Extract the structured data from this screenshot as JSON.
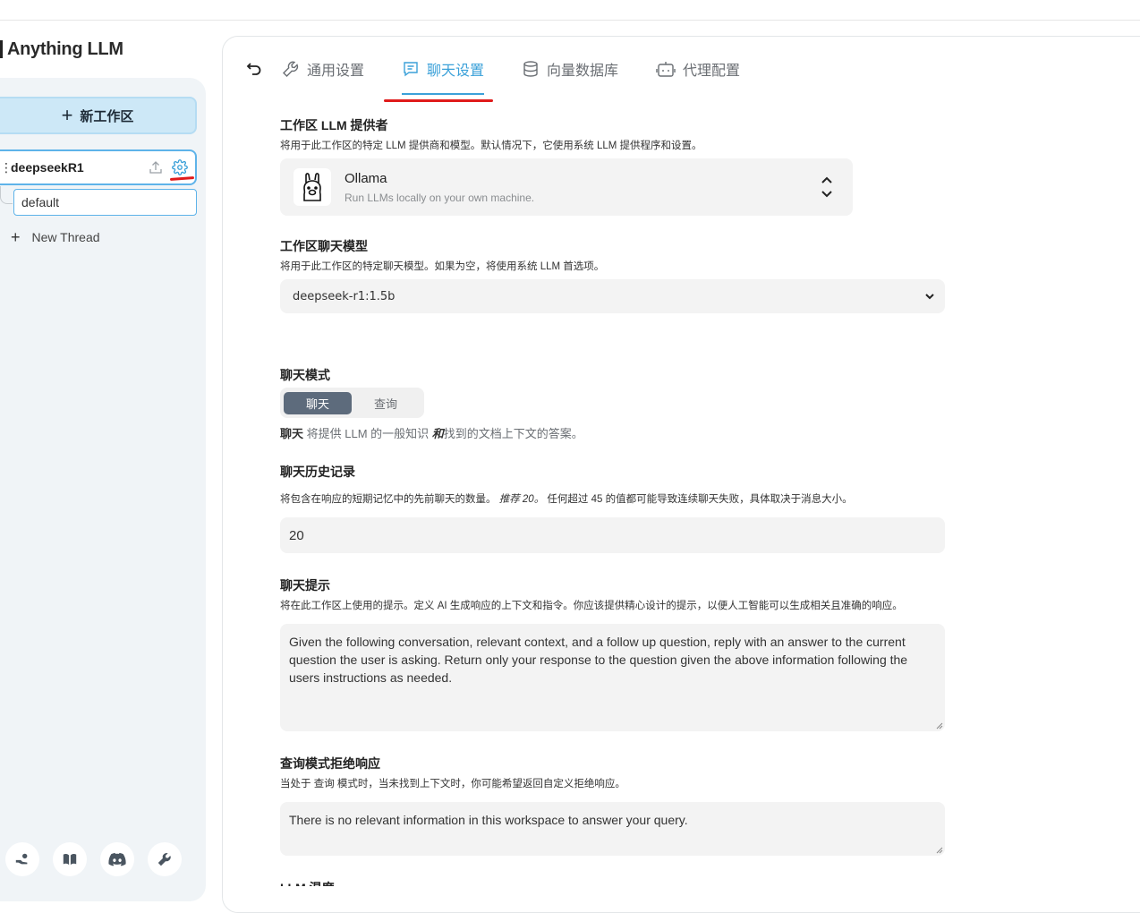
{
  "app": {
    "title": "Anything LLM"
  },
  "sidebar": {
    "new_workspace_label": "新工作区",
    "workspace": {
      "name": "deepseekR1"
    },
    "thread_default": "default",
    "new_thread_label": "New Thread",
    "footer_icons": [
      "community-hub-icon",
      "docs-book-icon",
      "discord-icon",
      "wrench-settings-icon"
    ]
  },
  "tabs": [
    {
      "label": "通用设置",
      "icon": "wrench-icon"
    },
    {
      "label": "聊天设置",
      "icon": "chat-icon",
      "active": true
    },
    {
      "label": "向量数据库",
      "icon": "database-icon"
    },
    {
      "label": "代理配置",
      "icon": "robot-icon"
    }
  ],
  "settings": {
    "provider": {
      "title": "工作区 LLM 提供者",
      "desc": "将用于此工作区的特定 LLM 提供商和模型。默认情况下，它使用系统 LLM 提供程序和设置。",
      "name": "Ollama",
      "subtitle": "Run LLMs locally on your own machine."
    },
    "model": {
      "title": "工作区聊天模型",
      "desc": "将用于此工作区的特定聊天模型。如果为空，将使用系统 LLM 首选项。",
      "value": "deepseek-r1:1.5b"
    },
    "mode": {
      "title": "聊天模式",
      "options": [
        "聊天",
        "查询"
      ],
      "selected": "聊天",
      "desc_lead": "聊天",
      "desc_mid": " 将提供 LLM 的一般知识 ",
      "desc_and": "和",
      "desc_tail": "找到的文档上下文的答案。"
    },
    "history": {
      "title": "聊天历史记录",
      "desc_a": "将包含在响应的短期记忆中的先前聊天的数量。",
      "desc_b": "推荐 20。",
      "desc_c": "任何超过 45 的值都可能导致连续聊天失败，具体取决于消息大小。",
      "value": "20"
    },
    "prompt": {
      "title": "聊天提示",
      "desc": "将在此工作区上使用的提示。定义 AI 生成响应的上下文和指令。你应该提供精心设计的提示，以便人工智能可以生成相关且准确的响应。",
      "value": "Given the following conversation, relevant context, and a follow up question, reply with an answer to the current question the user is asking. Return only your response to the question given the above information following the users instructions as needed."
    },
    "refusal": {
      "title": "查询模式拒绝响应",
      "desc": "当处于 查询 模式时，当未找到上下文时，你可能希望返回自定义拒绝响应。",
      "value": "There is no relevant information in this workspace to answer your query."
    },
    "next_section_title": "LLM 温度"
  },
  "colors": {
    "accent": "#3ba1d9",
    "annotation": "#e01b1b",
    "mode_active": "#5d6b7c"
  }
}
